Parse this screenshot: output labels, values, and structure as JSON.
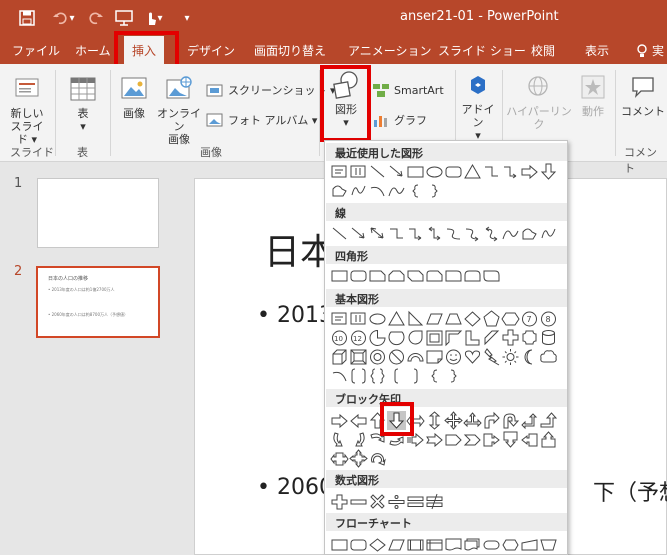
{
  "qat": {
    "save": "save-icon",
    "undo": "undo-icon",
    "redo": "redo-icon",
    "present": "presentation-icon",
    "touch": "touch-icon",
    "customize": "▾"
  },
  "window": {
    "title": "anser21-01  -  PowerPoint"
  },
  "tabs": [
    {
      "id": "file",
      "label": "ファイル"
    },
    {
      "id": "home",
      "label": "ホーム"
    },
    {
      "id": "insert",
      "label": "挿入"
    },
    {
      "id": "design",
      "label": "デザイン"
    },
    {
      "id": "transitions",
      "label": "画面切り替え"
    },
    {
      "id": "animations",
      "label": "アニメーション"
    },
    {
      "id": "slideshow",
      "label": "スライド ショー"
    },
    {
      "id": "review",
      "label": "校閲"
    },
    {
      "id": "view",
      "label": "表示"
    },
    {
      "id": "tellme",
      "label": "実"
    }
  ],
  "ribbon": {
    "new_slide": "新しい\nスライド ▾",
    "table": "表\n▾",
    "picture": "画像",
    "online_picture": "オンライン\n画像",
    "screenshot": "スクリーンショット ▾",
    "photo_album": "フォト アルバム ▾",
    "shapes": "図形\n▾",
    "smartart": "SmartArt",
    "chart": "グラフ",
    "addins": "アドイン\n▾",
    "hyperlink": "ハイパーリンク",
    "action": "動作",
    "comment": "コメント",
    "groups": {
      "slides": "スライド",
      "tables": "表",
      "images": "画像",
      "comments": "コメント"
    }
  },
  "thumbnails": [
    {
      "num": "1",
      "title": "",
      "lines": []
    },
    {
      "num": "2",
      "title": "日本の人口の推移",
      "lines": [
        "• 2013年度の人口は約1億2700万人",
        "• 2060年度の人口は約8700万人（予想値）"
      ]
    }
  ],
  "slide": {
    "title": "日本",
    "bullet1": "• 2013",
    "bullet2": "• 2060",
    "bullet2_tail": "下（予想"
  },
  "shapes_menu": {
    "sections": [
      {
        "id": "recent",
        "label": "最近使用した図形"
      },
      {
        "id": "lines",
        "label": "線"
      },
      {
        "id": "rect",
        "label": "四角形"
      },
      {
        "id": "basic",
        "label": "基本図形"
      },
      {
        "id": "block_arrows",
        "label": "ブロック矢印"
      },
      {
        "id": "equation",
        "label": "数式図形"
      },
      {
        "id": "flowchart",
        "label": "フローチャート"
      }
    ],
    "selected_shape": "down-arrow-icon"
  },
  "colors": {
    "brand": "#b7472a",
    "highlight": "#e30000",
    "selected_shape_bg": "#c6c6c6"
  }
}
